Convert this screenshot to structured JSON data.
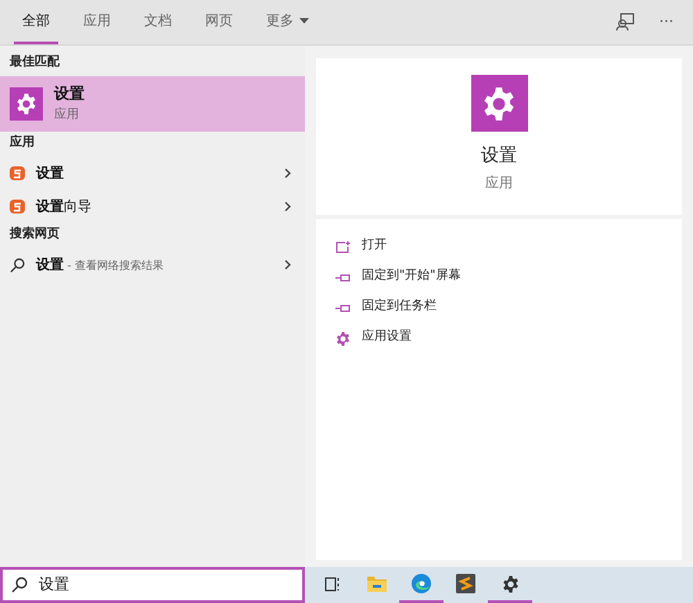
{
  "tabs": [
    {
      "label": "全部",
      "selected": true
    },
    {
      "label": "应用",
      "selected": false
    },
    {
      "label": "文档",
      "selected": false
    },
    {
      "label": "网页",
      "selected": false
    },
    {
      "label": "更多",
      "selected": false,
      "dropdown": true
    }
  ],
  "toolbar": {
    "more": "···"
  },
  "sections": [
    {
      "title": "最佳匹配",
      "items": [
        {
          "kind": "best",
          "title": "设置",
          "subtitle": "应用",
          "selected": true
        }
      ]
    },
    {
      "title": "应用",
      "items": [
        {
          "kind": "app",
          "title": "设置",
          "selected": false
        },
        {
          "kind": "app",
          "title": "**设置**向导",
          "selected": false
        }
      ]
    },
    {
      "title": "搜索网页",
      "items": [
        {
          "kind": "web",
          "title": "设置",
          "suffix": " - 查看网络搜索结果",
          "selected": false
        }
      ]
    }
  ],
  "preview": {
    "title": "设置",
    "subtitle": "应用"
  },
  "actions": [
    {
      "kind": "open",
      "label": "打开"
    },
    {
      "kind": "pin",
      "label": "固定到\"开始\"屏幕"
    },
    {
      "kind": "pin",
      "label": "固定到任务栏"
    },
    {
      "kind": "settings",
      "label": "应用设置"
    }
  ],
  "search": {
    "query": "设置"
  },
  "taskbar": [
    {
      "kind": "taskview",
      "running": false
    },
    {
      "kind": "folder",
      "running": false
    },
    {
      "kind": "edge",
      "running": true
    },
    {
      "kind": "editor",
      "running": false
    },
    {
      "kind": "gear",
      "running": true
    }
  ]
}
